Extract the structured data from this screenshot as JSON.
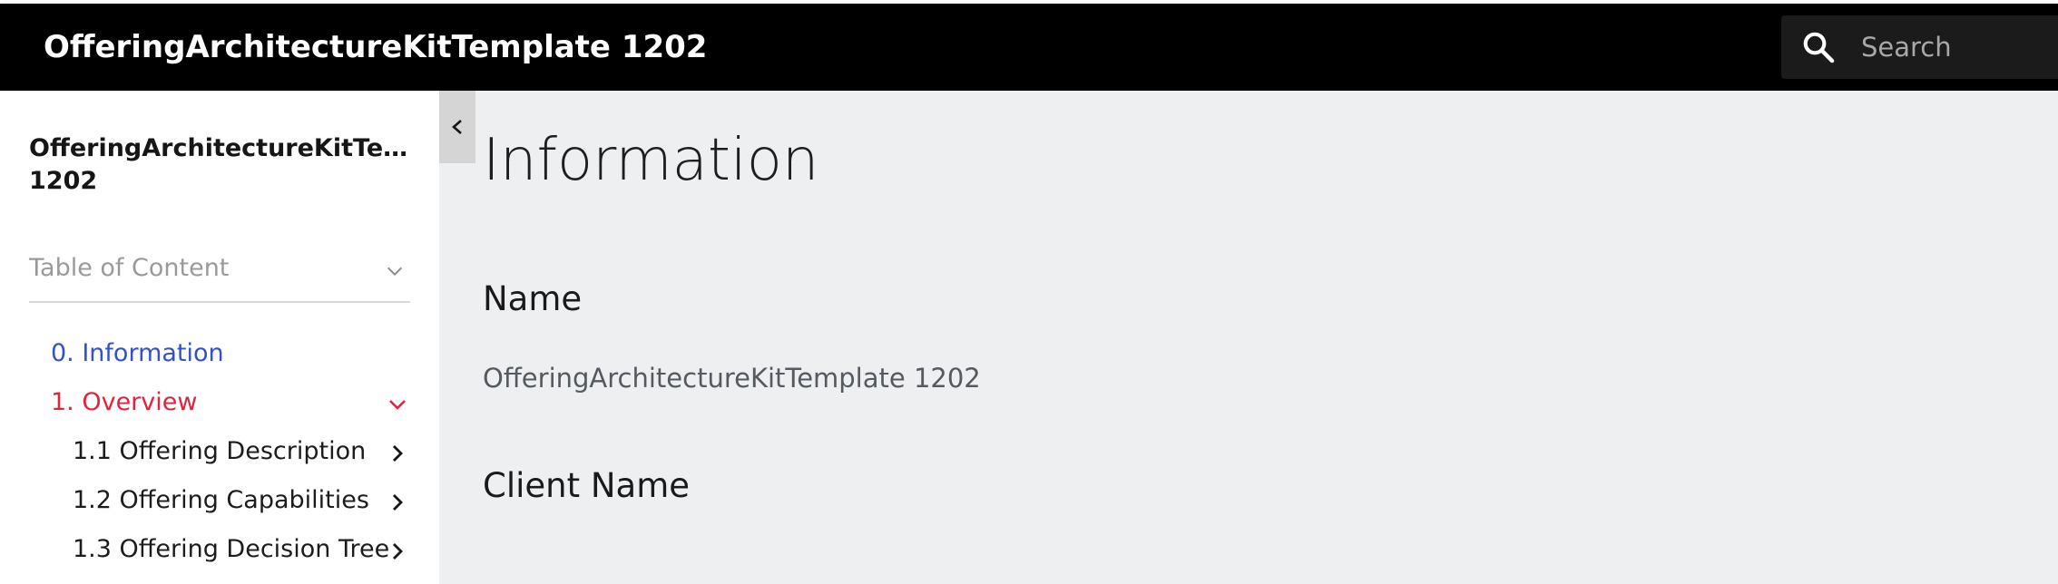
{
  "header": {
    "title": "OfferingArchitectureKitTemplate 1202",
    "search_placeholder": "Search",
    "search_value": ""
  },
  "sidebar": {
    "title_line1": "OfferingArchitectureKitTempl...",
    "title_line2": "1202",
    "toc_label": "Table of Content",
    "items": [
      {
        "label": "0. Information",
        "state": "active"
      },
      {
        "label": "1. Overview",
        "state": "expanded"
      },
      {
        "label": "1.1 Offering Description"
      },
      {
        "label": "1.2 Offering Capabilities"
      },
      {
        "label": "1.3 Offering Decision Tree"
      }
    ]
  },
  "main": {
    "page_title": "Information",
    "fields": [
      {
        "label": "Name",
        "value": "OfferingArchitectureKitTemplate 1202"
      },
      {
        "label": "Client Name"
      }
    ]
  },
  "colors": {
    "header_bg": "#000000",
    "content_bg": "#eeeff1",
    "link_blue": "#3552c4",
    "active_red": "#e0243e"
  },
  "icons": {
    "search": "search-icon",
    "toc_toggle": "chevron-down-icon",
    "collapse": "chevron-left-icon",
    "expand_item": "chevron-right-icon"
  }
}
